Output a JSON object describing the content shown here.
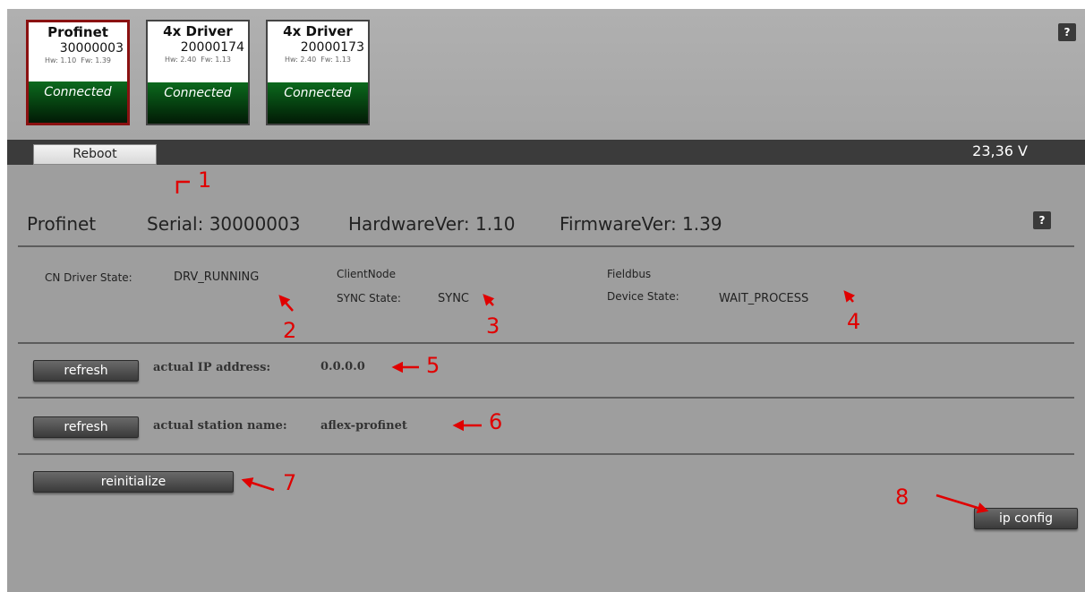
{
  "devices": [
    {
      "name": "Profinet",
      "serial": "30000003",
      "hw": "Hw: 1.10",
      "fw": "Fw: 1.39",
      "status": "Connected"
    },
    {
      "name": "4x Driver",
      "serial": "20000174",
      "hw": "Hw: 2.40",
      "fw": "Fw: 1.13",
      "status": "Connected"
    },
    {
      "name": "4x Driver",
      "serial": "20000173",
      "hw": "Hw: 2.40",
      "fw": "Fw: 1.13",
      "status": "Connected"
    }
  ],
  "help_label": "?",
  "reboot_label": "Reboot",
  "voltage": "23,36 V",
  "header": {
    "name": "Profinet",
    "serial": "Serial: 30000003",
    "hw": "HardwareVer: 1.10",
    "fw": "FirmwareVer: 1.39"
  },
  "states": {
    "cn_label": "CN Driver State:",
    "cn_value": "DRV_RUNNING",
    "client_label1": "ClientNode",
    "client_label2": "SYNC State:",
    "client_value": "SYNC",
    "fieldbus_label1": "Fieldbus",
    "fieldbus_label2": "Device State:",
    "fieldbus_value": "WAIT_PROCESS"
  },
  "ip": {
    "button": "refresh",
    "label": "actual IP address:",
    "value": "0.0.0.0"
  },
  "station": {
    "button": "refresh",
    "label": "actual station name:",
    "value": "aflex-profinet"
  },
  "reinit_label": "reinitialize",
  "ipconfig_label": "ip config",
  "annotations": {
    "n1": "1",
    "n2": "2",
    "n3": "3",
    "n4": "4",
    "n5": "5",
    "n6": "6",
    "n7": "7",
    "n8": "8"
  },
  "colors": {
    "connected": "#0c6a1e",
    "selected_border": "#8a1111",
    "annotation": "#e00000",
    "panel": "#9e9e9e"
  }
}
